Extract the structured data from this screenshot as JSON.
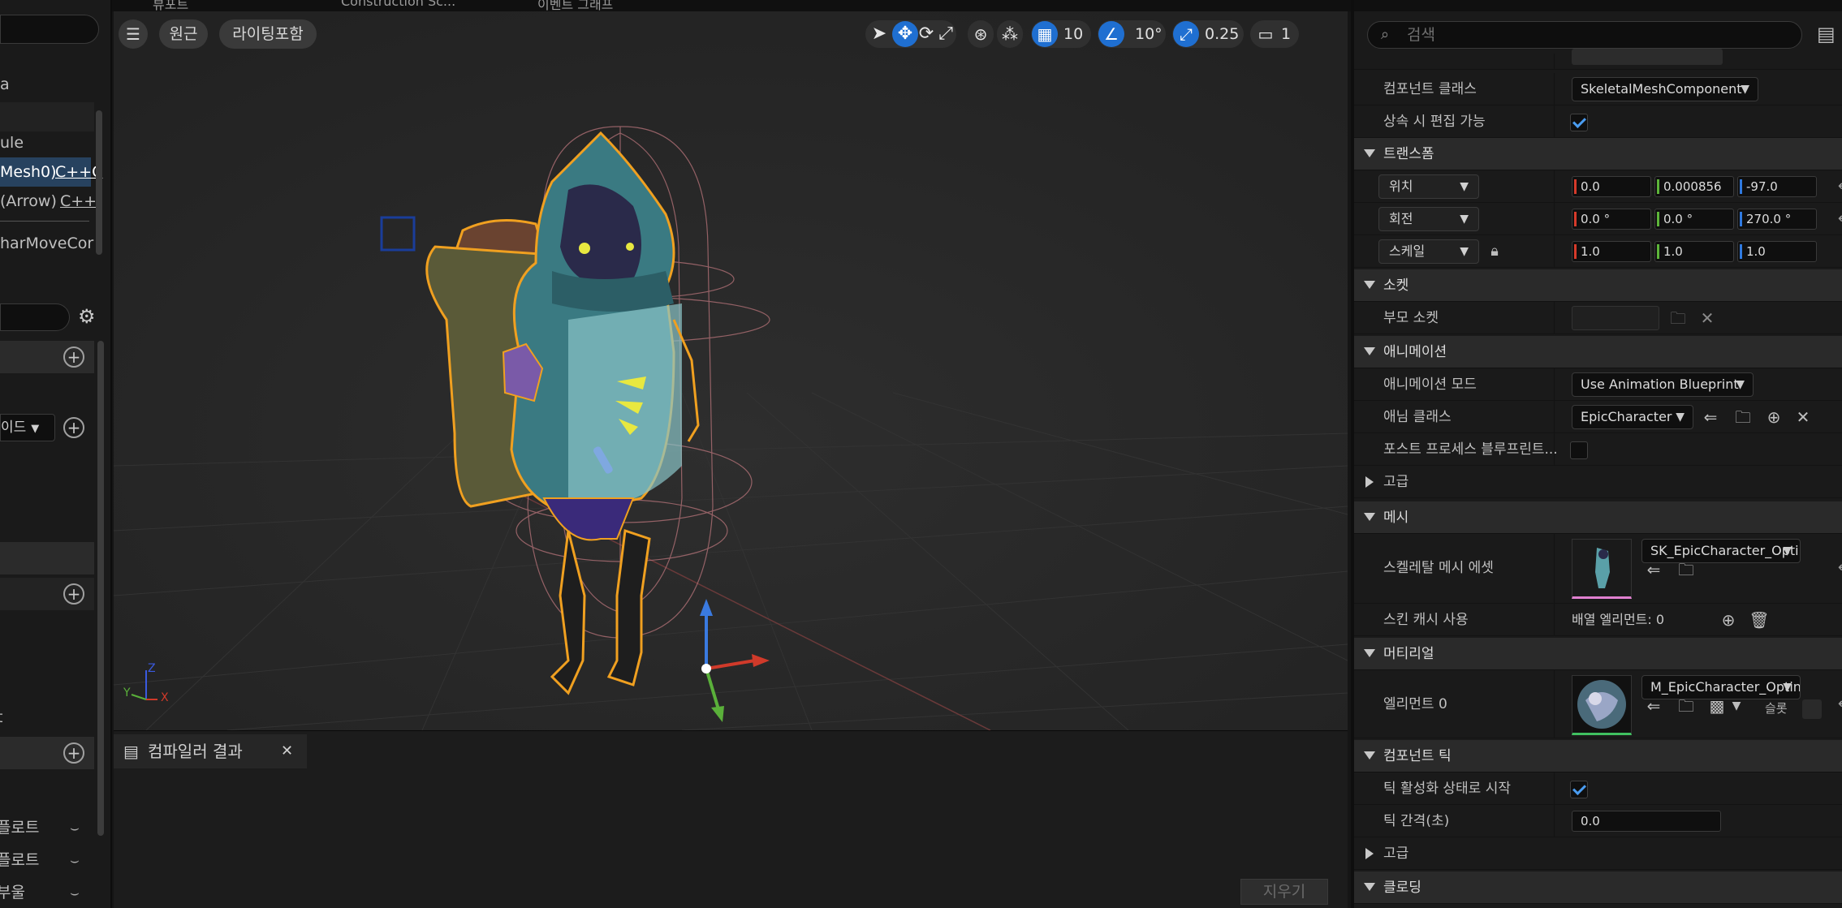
{
  "left_panel": {
    "rows": [
      "a",
      "ule",
      "Mesh0)",
      "(Arrow)",
      "harMoveCor",
      "이드",
      "t",
      "플로트",
      "플로트",
      "부울"
    ],
    "cpp_tags": [
      "C++C",
      "C++"
    ]
  },
  "tabs": [
    "뷰포트",
    "Construction Sc...",
    "이벤트 그래프"
  ],
  "viewport": {
    "menu_icon": "hamburger-icon",
    "perspective_label": "원근",
    "lighting_label": "라이팅포함",
    "grid_snap_value": "10",
    "rotation_snap_value": "10°",
    "scale_snap_value": "0.25",
    "camera_speed_value": "1",
    "axis_y": "Y",
    "axis_z": "Z",
    "axis_x": "X"
  },
  "compiler": {
    "tab_label": "컴파일러 결과",
    "clear_label": "지우기"
  },
  "details": {
    "search_placeholder": "검색",
    "rows": {
      "component_class_label": "컴포넌트 클래스",
      "component_class_value": "SkeletalMeshComponent",
      "editable_inherit_label": "상속 시 편집 가능",
      "transform_cat": "트랜스폼",
      "location_label": "위치",
      "location": [
        "0.0",
        "0.000856",
        "-97.0"
      ],
      "rotation_label": "회전",
      "rotation": [
        "0.0 °",
        "0.0 °",
        "270.0 °"
      ],
      "scale_label": "스케일",
      "scale": [
        "1.0",
        "1.0",
        "1.0"
      ],
      "sockets_cat": "소켓",
      "parent_socket_label": "부모 소켓",
      "animation_cat": "애니메이션",
      "anim_mode_label": "애니메이션 모드",
      "anim_mode_value": "Use Animation Blueprint",
      "anim_class_label": "애님 클래스",
      "anim_class_value": "EpicCharacter",
      "post_process_label": "포스트 프로세스 블루프린트...",
      "advanced_label": "고급",
      "mesh_cat": "메시",
      "skeletal_mesh_label": "스켈레탈 메시 에셋",
      "skeletal_mesh_value": "SK_EpicCharacter_Optin",
      "skin_cache_label": "스킨 캐시 사용",
      "skin_cache_value": "배열 엘리먼트: 0",
      "materials_cat": "머티리얼",
      "element0_label": "엘리먼트 0",
      "material_value": "M_EpicCharacter_Optin",
      "slot_label": "슬롯",
      "tick_cat": "컴포넌트 틱",
      "tick_start_label": "틱 활성화 상태로 시작",
      "tick_interval_label": "틱 간격(초)",
      "tick_interval_value": "0.0",
      "advanced2_label": "고급",
      "cloth_cat": "클로딩"
    }
  }
}
